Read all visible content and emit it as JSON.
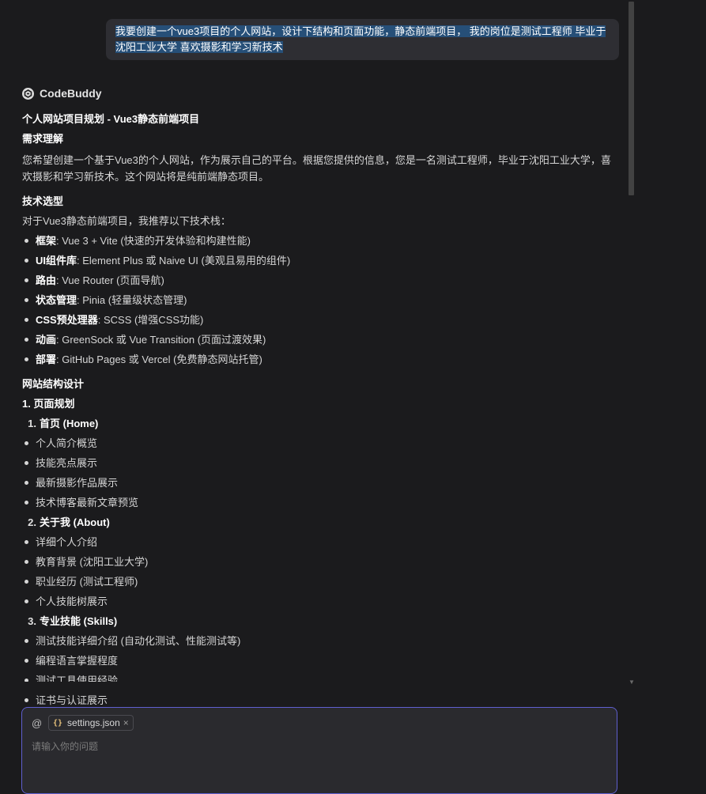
{
  "user_message": {
    "text": "我要创建一个vue3项目的个人网站，设计下结构和页面功能，静态前端项目， 我的岗位是测试工程师 毕业于沈阳工业大学 喜欢摄影和学习新技术"
  },
  "assistant": {
    "name": "CodeBuddy",
    "title": "个人网站项目规划 - Vue3静态前端项目",
    "section_requirements": {
      "heading": "需求理解",
      "body": "您希望创建一个基于Vue3的个人网站，作为展示自己的平台。根据您提供的信息，您是一名测试工程师，毕业于沈阳工业大学，喜欢摄影和学习新技术。这个网站将是纯前端静态项目。"
    },
    "section_tech": {
      "heading": "技术选型",
      "intro": "对于Vue3静态前端项目，我推荐以下技术栈：",
      "items": [
        {
          "key": "框架",
          "value": ": Vue 3 + Vite (快速的开发体验和构建性能)"
        },
        {
          "key": "UI组件库",
          "value": ": Element Plus 或 Naive UI (美观且易用的组件)"
        },
        {
          "key": "路由",
          "value": ": Vue Router (页面导航)"
        },
        {
          "key": "状态管理",
          "value": ": Pinia (轻量级状态管理)"
        },
        {
          "key": "CSS预处理器",
          "value": ": SCSS (增强CSS功能)"
        },
        {
          "key": "动画",
          "value": ": GreenSock 或 Vue Transition (页面过渡效果)"
        },
        {
          "key": "部署",
          "value": ": GitHub Pages 或 Vercel (免费静态网站托管)"
        }
      ]
    },
    "section_structure": {
      "heading": "网站结构设计",
      "subheading": "1. 页面规划",
      "pages": [
        {
          "num": "1.",
          "title": "首页 (Home)",
          "items": [
            "个人简介概览",
            "技能亮点展示",
            "最新摄影作品展示",
            "技术博客最新文章预览"
          ]
        },
        {
          "num": "2.",
          "title": "关于我 (About)",
          "items": [
            "详细个人介绍",
            "教育背景 (沈阳工业大学)",
            "职业经历 (测试工程师)",
            "个人技能树展示"
          ]
        },
        {
          "num": "3.",
          "title": "专业技能 (Skills)",
          "items": [
            "测试技能详细介绍 (自动化测试、性能测试等)",
            "编程语言掌握程度",
            "测试工具使用经验",
            "证书与认证展示"
          ]
        }
      ]
    }
  },
  "input": {
    "at_symbol": "@",
    "attachment": "settings.json",
    "attachment_icon": "{}",
    "close_glyph": "×",
    "placeholder": "请输入你的问题"
  },
  "colors": {
    "background": "#1b1b1d",
    "selection": "#264f78",
    "input_border": "#5f5fcf"
  }
}
